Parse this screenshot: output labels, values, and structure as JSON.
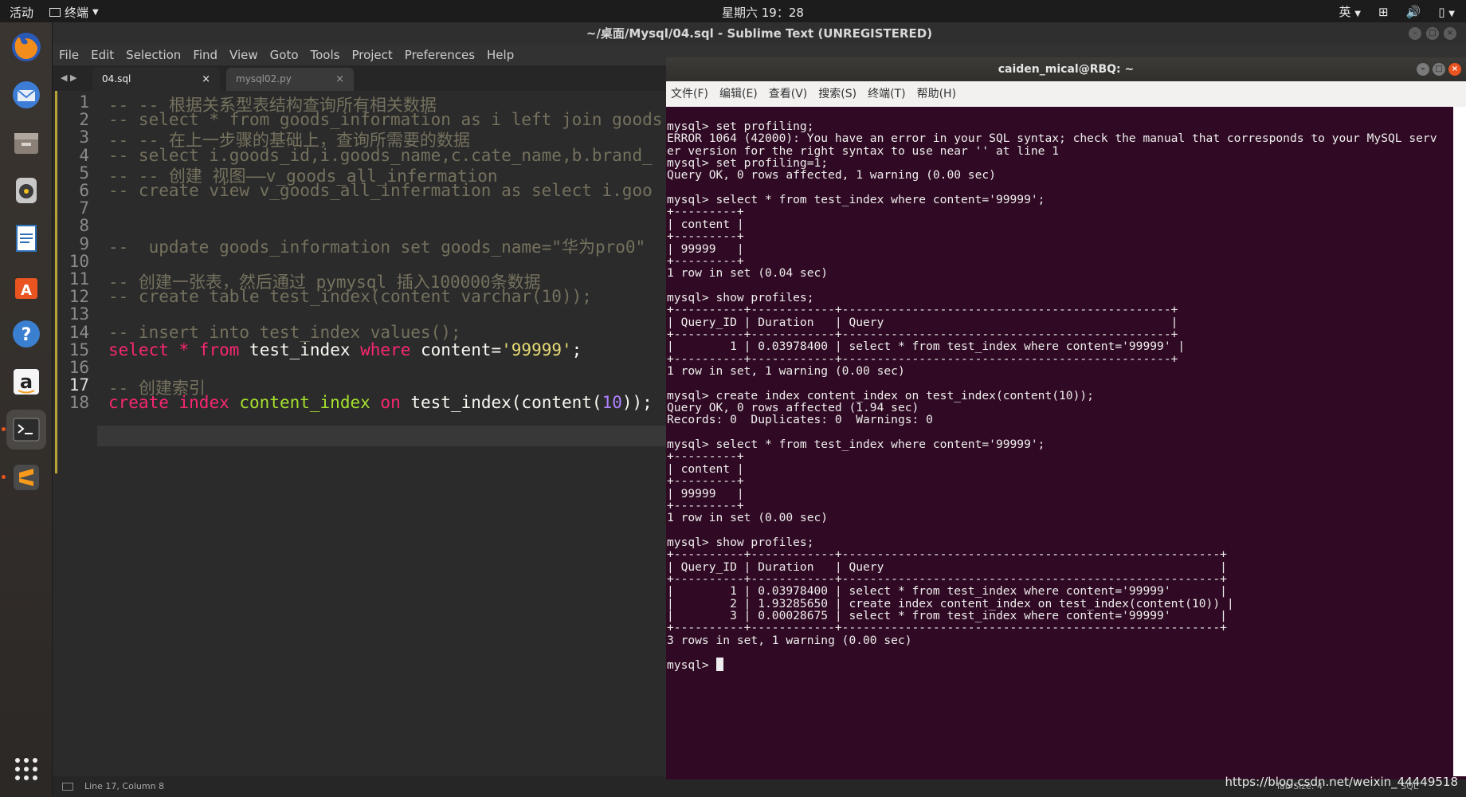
{
  "top_panel": {
    "activities": "活动",
    "app_name": "终端",
    "clock": "星期六 19：28",
    "input_method": "英"
  },
  "sublime": {
    "title": "~/桌面/Mysql/04.sql - Sublime Text (UNREGISTERED)",
    "menu": [
      "File",
      "Edit",
      "Selection",
      "Find",
      "View",
      "Goto",
      "Tools",
      "Project",
      "Preferences",
      "Help"
    ],
    "tabs": [
      {
        "label": "04.sql",
        "active": true
      },
      {
        "label": "mysql02.py",
        "active": false
      }
    ],
    "status_left": "Line 17, Column 8",
    "status_tabsize": "Tab Size: 4",
    "status_syntax": "SQL"
  },
  "editor_lines": [
    {
      "n": "1",
      "segs": [
        [
          "c",
          "-- -- 根据关系型表结构查询所有相关数据"
        ]
      ]
    },
    {
      "n": "2",
      "segs": [
        [
          "c",
          "-- select * from goods_information as i left join goods"
        ]
      ]
    },
    {
      "n": "3",
      "segs": [
        [
          "c",
          "-- -- 在上一步骤的基础上，查询所需要的数据"
        ]
      ]
    },
    {
      "n": "4",
      "segs": [
        [
          "c",
          "-- select i.goods_id,i.goods_name,c.cate_name,b.brand_"
        ]
      ]
    },
    {
      "n": "5",
      "segs": [
        [
          "c",
          "-- -- 创建 视图——v_goods_all_infermation"
        ]
      ]
    },
    {
      "n": "6",
      "segs": [
        [
          "c",
          "-- create view v_goods_all_infermation as select i.goo"
        ]
      ]
    },
    {
      "n": "7",
      "segs": []
    },
    {
      "n": "8",
      "segs": []
    },
    {
      "n": "9",
      "segs": [
        [
          "c",
          "--  update goods_information set goods_name=\"华为pro0\""
        ]
      ]
    },
    {
      "n": "10",
      "segs": []
    },
    {
      "n": "11",
      "segs": [
        [
          "c",
          "-- 创建一张表，然后通过 pymysql 插入100000条数据"
        ]
      ]
    },
    {
      "n": "12",
      "segs": [
        [
          "c",
          "-- create table test_index(content varchar(10));"
        ]
      ]
    },
    {
      "n": "13",
      "segs": []
    },
    {
      "n": "14",
      "segs": [
        [
          "c",
          "-- insert into test_index values();"
        ]
      ]
    },
    {
      "n": "15",
      "segs": [
        [
          "k",
          "select"
        ],
        [
          "t",
          " "
        ],
        [
          "k",
          "*"
        ],
        [
          "t",
          " "
        ],
        [
          "k",
          "from"
        ],
        [
          "t",
          " test_index "
        ],
        [
          "k",
          "where"
        ],
        [
          "t",
          " content="
        ],
        [
          "s",
          "'99999'"
        ],
        [
          "t",
          ";"
        ]
      ]
    },
    {
      "n": "16",
      "segs": []
    },
    {
      "n": "17",
      "segs": [
        [
          "c",
          "-- 创建索引"
        ]
      ]
    },
    {
      "n": "18",
      "segs": [
        [
          "k",
          "create"
        ],
        [
          "t",
          " "
        ],
        [
          "k",
          "index"
        ],
        [
          "t",
          " "
        ],
        [
          "f",
          "content_index"
        ],
        [
          "t",
          " "
        ],
        [
          "k",
          "on"
        ],
        [
          "t",
          " test_index(content("
        ],
        [
          "n",
          "10"
        ],
        [
          "t",
          "));"
        ]
      ]
    }
  ],
  "terminal": {
    "title": "caiden_mical@RBQ: ~",
    "menu": [
      "文件(F)",
      "编辑(E)",
      "查看(V)",
      "搜索(S)",
      "终端(T)",
      "帮助(H)"
    ],
    "lines": [
      "mysql> set profiling;",
      "ERROR 1064 (42000): You have an error in your SQL syntax; check the manual that corresponds to your MySQL serv",
      "er version for the right syntax to use near '' at line 1",
      "mysql> set profiling=1;",
      "Query OK, 0 rows affected, 1 warning (0.00 sec)",
      "",
      "mysql> select * from test_index where content='99999';",
      "+---------+",
      "| content |",
      "+---------+",
      "| 99999   |",
      "+---------+",
      "1 row in set (0.04 sec)",
      "",
      "mysql> show profiles;",
      "+----------+------------+-----------------------------------------------+",
      "| Query_ID | Duration   | Query                                         |",
      "+----------+------------+-----------------------------------------------+",
      "|        1 | 0.03978400 | select * from test_index where content='99999' |",
      "+----------+------------+-----------------------------------------------+",
      "1 row in set, 1 warning (0.00 sec)",
      "",
      "mysql> create index content_index on test_index(content(10));",
      "Query OK, 0 rows affected (1.94 sec)",
      "Records: 0  Duplicates: 0  Warnings: 0",
      "",
      "mysql> select * from test_index where content='99999';",
      "+---------+",
      "| content |",
      "+---------+",
      "| 99999   |",
      "+---------+",
      "1 row in set (0.00 sec)",
      "",
      "mysql> show profiles;",
      "+----------+------------+------------------------------------------------------+",
      "| Query_ID | Duration   | Query                                                |",
      "+----------+------------+------------------------------------------------------+",
      "|        1 | 0.03978400 | select * from test_index where content='99999'       |",
      "|        2 | 1.93285650 | create index content_index on test_index(content(10)) |",
      "|        3 | 0.00028675 | select * from test_index where content='99999'       |",
      "+----------+------------+------------------------------------------------------+",
      "3 rows in set, 1 warning (0.00 sec)",
      "",
      "mysql> "
    ]
  },
  "watermark": "https://blog.csdn.net/weixin_44449518",
  "colors": {
    "terminal_bg": "#300a24",
    "ubuntu_orange": "#e95420",
    "monokai_keyword": "#f92672",
    "monokai_string": "#e6db74",
    "monokai_comment": "#75715e"
  }
}
